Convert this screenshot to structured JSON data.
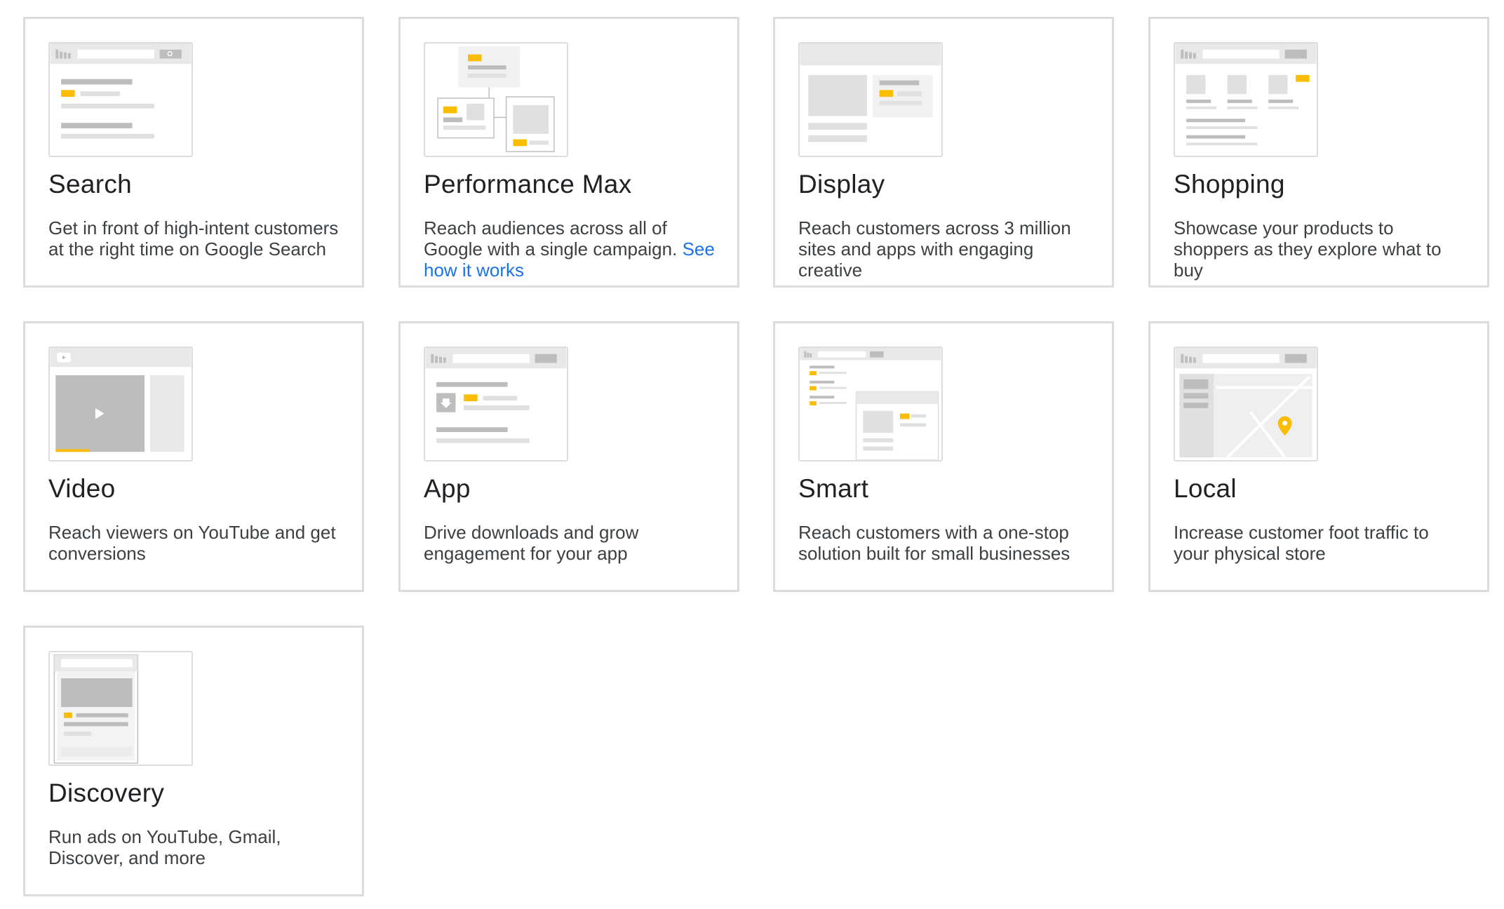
{
  "campaign_types": [
    {
      "title": "Search",
      "description": "Get in front of high-intent customers at the right time on Google Search",
      "icon": "search-ad-illustration-icon"
    },
    {
      "title": "Performance Max",
      "description": "Reach audiences across all of Google with a single campaign.",
      "link": "See how it works",
      "icon": "performance-max-illustration-icon"
    },
    {
      "title": "Display",
      "description": "Reach customers across 3 million sites and apps with engaging creative",
      "icon": "display-ad-illustration-icon"
    },
    {
      "title": "Shopping",
      "description": "Showcase your products to shoppers as they explore what to buy",
      "icon": "shopping-ad-illustration-icon"
    },
    {
      "title": "Video",
      "description": "Reach viewers on YouTube and get conversions",
      "icon": "video-ad-illustration-icon"
    },
    {
      "title": "App",
      "description": "Drive downloads and grow engagement for your app",
      "icon": "app-ad-illustration-icon"
    },
    {
      "title": "Smart",
      "description": "Reach customers with a one-stop solution built for small businesses",
      "icon": "smart-ad-illustration-icon"
    },
    {
      "title": "Local",
      "description": "Increase customer foot traffic to your physical store",
      "icon": "local-ad-illustration-icon"
    },
    {
      "title": "Discovery",
      "description": "Run ads on YouTube, Gmail, Discover, and more",
      "icon": "discovery-ad-illustration-icon"
    }
  ],
  "colors": {
    "accent": "#fbbc04",
    "link": "#1a73e8",
    "border": "#dadce0",
    "illustration_gray": "#e0e0e0"
  }
}
